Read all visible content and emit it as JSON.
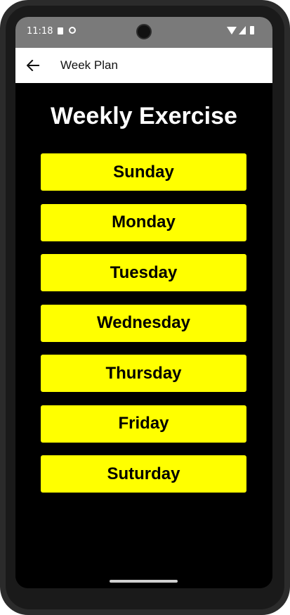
{
  "status_bar": {
    "time": "11:18"
  },
  "app_bar": {
    "title": "Week Plan",
    "back_icon": "arrow-left-icon"
  },
  "main": {
    "title": "Weekly Exercise",
    "days": [
      {
        "label": "Sunday"
      },
      {
        "label": "Monday"
      },
      {
        "label": "Tuesday"
      },
      {
        "label": "Wednesday"
      },
      {
        "label": "Thursday"
      },
      {
        "label": "Friday"
      },
      {
        "label": "Suturday"
      }
    ]
  },
  "colors": {
    "button_background": "#ffff00",
    "screen_background": "#000000",
    "app_bar_background": "#ffffff",
    "status_bar_background": "#7a7a7a"
  }
}
